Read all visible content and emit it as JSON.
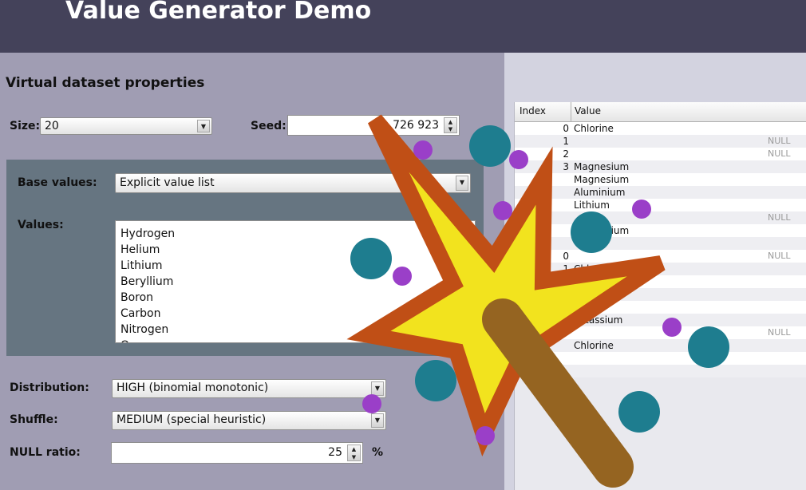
{
  "window": {
    "title": "Value Generator Demo"
  },
  "properties": {
    "heading": "Virtual dataset properties",
    "size_label": "Size:",
    "size_value": "20",
    "seed_label": "Seed:",
    "seed_value": "726 923",
    "base_values_label": "Base values:",
    "base_values_value": "Explicit value list",
    "values_label": "Values:",
    "values": [
      "Hydrogen",
      "Helium",
      "Lithium",
      "Beryllium",
      "Boron",
      "Carbon",
      "Nitrogen",
      "Oxygen"
    ],
    "distribution_label": "Distribution:",
    "distribution_value": "HIGH (binomial monotonic)",
    "shuffle_label": "Shuffle:",
    "shuffle_value": "MEDIUM (special heuristic)",
    "null_ratio_label": "NULL ratio:",
    "null_ratio_value": "25",
    "null_ratio_unit": "%"
  },
  "table": {
    "columns": [
      "Index",
      "Value"
    ],
    "null_text": "NULL",
    "rows": [
      {
        "index": "0",
        "value": "Chlorine",
        "null": false
      },
      {
        "index": "1",
        "value": "",
        "null": true
      },
      {
        "index": "2",
        "value": "",
        "null": true
      },
      {
        "index": "3",
        "value": "Magnesium",
        "null": false
      },
      {
        "index": "",
        "value": "Magnesium",
        "null": false
      },
      {
        "index": "",
        "value": "Aluminium",
        "null": false
      },
      {
        "index": "",
        "value": "Lithium",
        "null": false
      },
      {
        "index": "",
        "value": "",
        "null": true
      },
      {
        "index": "",
        "value": "Magnesium",
        "null": false
      },
      {
        "index": "",
        "value": "",
        "null": false
      },
      {
        "index": "0",
        "value": "",
        "null": true
      },
      {
        "index": "1",
        "value": "Chlorine",
        "null": false
      },
      {
        "index": "",
        "value": "",
        "null": false
      },
      {
        "index": "",
        "value": "",
        "null": false
      },
      {
        "index": "",
        "value": "",
        "null": false
      },
      {
        "index": "",
        "value": "Potassium",
        "null": false
      },
      {
        "index": "",
        "value": "",
        "null": true
      },
      {
        "index": "",
        "value": "Chlorine",
        "null": false
      },
      {
        "index": "",
        "value": "",
        "null": false
      },
      {
        "index": "",
        "value": "",
        "null": false
      }
    ]
  },
  "icons": {
    "dropdown": "chevron-down-icon",
    "spinner": "spinner-arrows-icon",
    "overlay": "magic-wand-icon"
  },
  "colors": {
    "titlebar": "#44425a",
    "panel": "#a09db3",
    "base_box": "#667581",
    "table_panel": "#d3d3e0",
    "star_fill": "#f2e31e",
    "star_stroke": "#c04f16",
    "wand": "#956421",
    "dot_teal": "#1e7d8f",
    "dot_purple": "#9a3fc8"
  }
}
